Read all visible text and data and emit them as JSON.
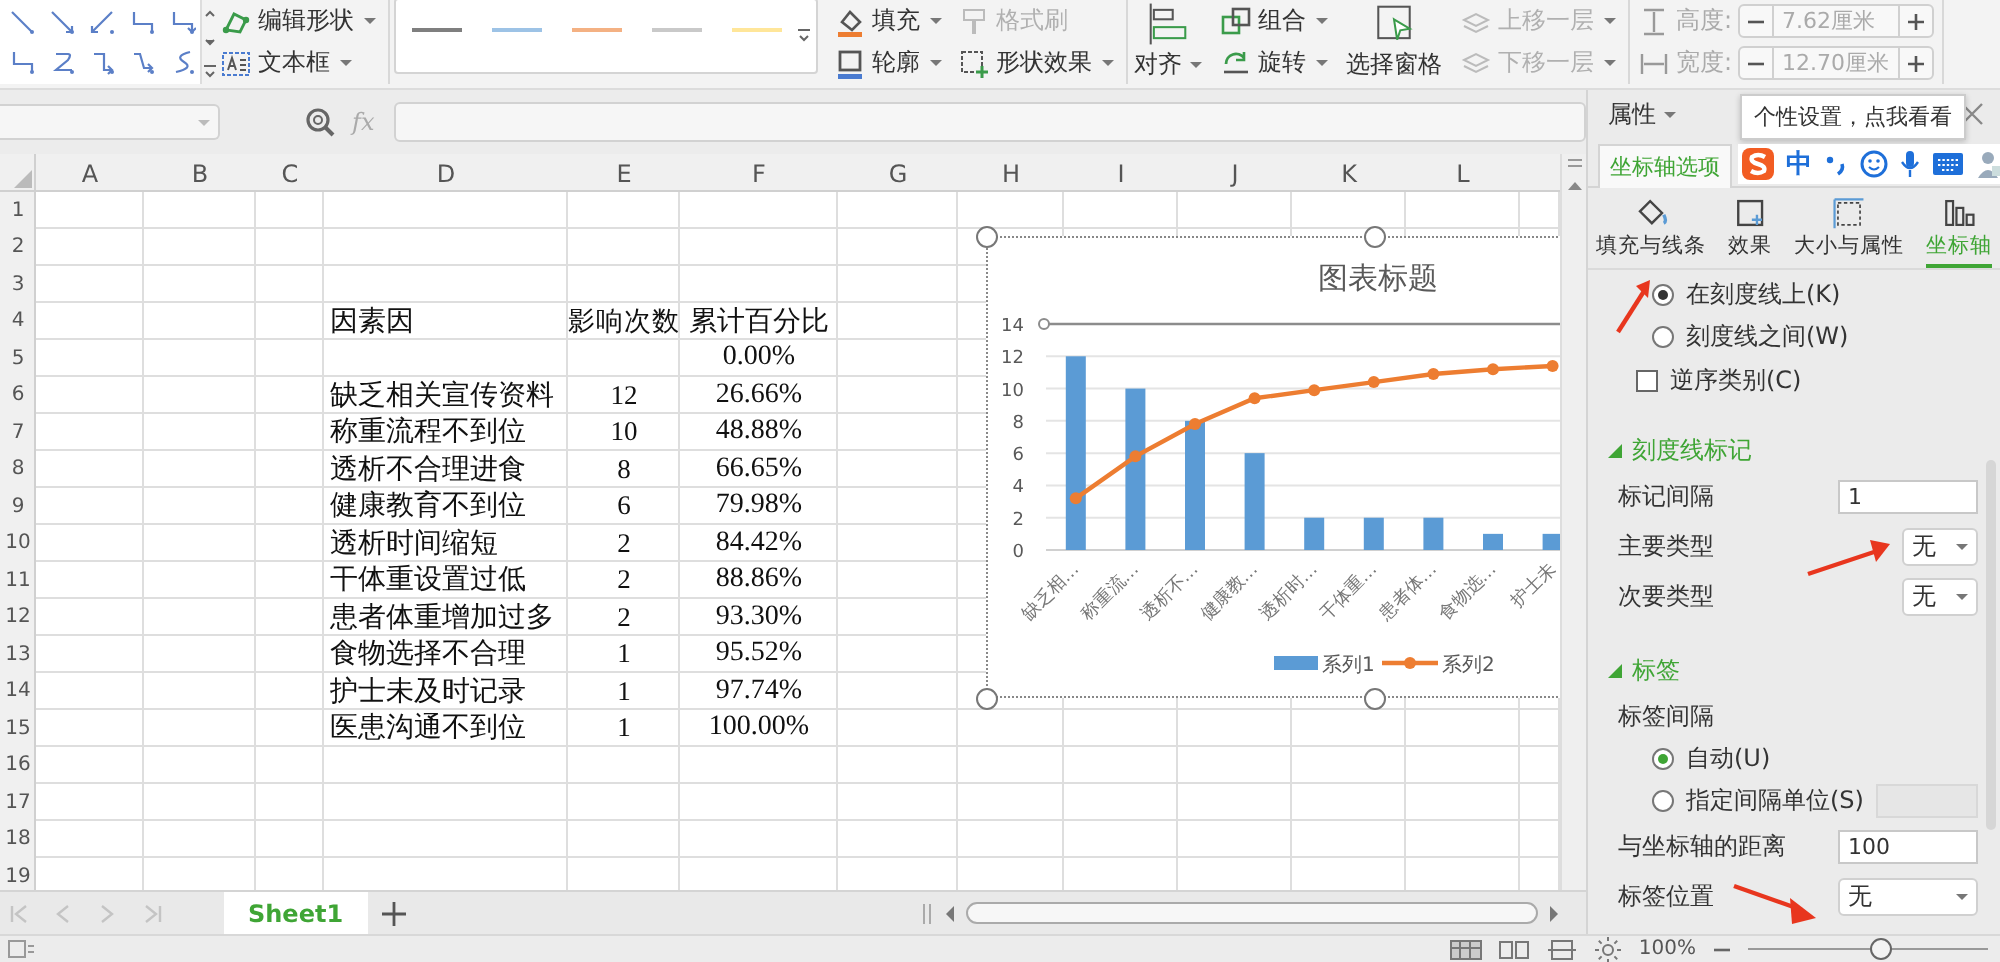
{
  "ribbon": {
    "groups": [
      {
        "columns": [
          {
            "kind": "shape-gallery"
          },
          {
            "kind": "stack",
            "items": [
              {
                "label": "编辑形状",
                "dropdown": true,
                "disabled": false
              },
              {
                "label": "文本框",
                "dropdown": true,
                "disabled": false
              }
            ]
          }
        ]
      },
      {
        "columns": [
          {
            "kind": "style-gallery",
            "swatches": [
              {
                "color": "#7f7f7f"
              },
              {
                "color": "#9dc3e6"
              },
              {
                "color": "#f4b183"
              },
              {
                "color": "#c9c9c9"
              },
              {
                "color": "#ffe699"
              }
            ]
          },
          {
            "kind": "stack",
            "items": [
              {
                "label": "填充",
                "dropdown": true,
                "disabled": false
              },
              {
                "label": "轮廓",
                "dropdown": true,
                "disabled": false
              }
            ]
          },
          {
            "kind": "stack",
            "items": [
              {
                "label": "格式刷",
                "dropdown": false,
                "disabled": true
              },
              {
                "label": "形状效果",
                "dropdown": true,
                "disabled": false
              }
            ]
          }
        ]
      },
      {
        "columns": [
          {
            "kind": "large",
            "item": {
              "label": "对齐",
              "dropdown": true,
              "disabled": false
            }
          },
          {
            "kind": "stack",
            "items": [
              {
                "label": "组合",
                "dropdown": true,
                "disabled": false
              },
              {
                "label": "旋转",
                "dropdown": true,
                "disabled": false
              }
            ]
          },
          {
            "kind": "large",
            "item": {
              "label": "选择窗格",
              "dropdown": false,
              "disabled": false
            }
          },
          {
            "kind": "stack",
            "items": [
              {
                "label": "上移一层",
                "dropdown": true,
                "disabled": true
              },
              {
                "label": "下移一层",
                "dropdown": true,
                "disabled": true
              }
            ]
          }
        ]
      },
      {
        "columns": [
          {
            "kind": "spinners",
            "items": [
              {
                "label": "高度:",
                "value": "7.62厘米",
                "disabled": true
              },
              {
                "label": "宽度:",
                "value": "12.70厘米",
                "disabled": true
              }
            ]
          }
        ]
      }
    ]
  },
  "formula_bar": {
    "fx": "fx"
  },
  "sheet": {
    "columns": [
      "A",
      "B",
      "C",
      "D",
      "E",
      "F",
      "G",
      "H",
      "I",
      "J",
      "K",
      "L"
    ],
    "rows": [
      {
        "number": "1"
      },
      {
        "number": "2"
      },
      {
        "number": "3"
      },
      {
        "number": "4",
        "d": "因素因",
        "e": "影响次数",
        "f": "累计百分比"
      },
      {
        "number": "5",
        "f": "0.00%"
      },
      {
        "number": "6",
        "d": "缺乏相关宣传资料",
        "e": "12",
        "f": "26.66%"
      },
      {
        "number": "7",
        "d": "称重流程不到位",
        "e": "10",
        "f": "48.88%"
      },
      {
        "number": "8",
        "d": "透析不合理进食",
        "e": "8",
        "f": "66.65%"
      },
      {
        "number": "9",
        "d": "健康教育不到位",
        "e": "6",
        "f": "79.98%"
      },
      {
        "number": "10",
        "d": "透析时间缩短",
        "e": "2",
        "f": "84.42%"
      },
      {
        "number": "11",
        "d": "干体重设置过低",
        "e": "2",
        "f": "88.86%"
      },
      {
        "number": "12",
        "d": "患者体重增加过多",
        "e": "2",
        "f": "93.30%"
      },
      {
        "number": "13",
        "d": "食物选择不合理",
        "e": "1",
        "f": "95.52%"
      },
      {
        "number": "14",
        "d": "护士未及时记录",
        "e": "1",
        "f": "97.74%"
      },
      {
        "number": "15",
        "d": "医患沟通不到位",
        "e": "1",
        "f": "100.00%"
      },
      {
        "number": "16"
      },
      {
        "number": "17"
      },
      {
        "number": "18"
      },
      {
        "number": "19"
      }
    ],
    "chart": {
      "chart_data": {
        "type": "bar",
        "title": "图表标题",
        "categories": [
          "缺乏相…",
          "称重流…",
          "透析不…",
          "健康教…",
          "透析时…",
          "干体重…",
          "患者体…",
          "食物选…",
          "护士未"
        ],
        "series": [
          {
            "name": "系列1",
            "color": "#5b9bd5",
            "type": "bar",
            "values": [
              12,
              10,
              8,
              6,
              2,
              2,
              2,
              1,
              1
            ]
          },
          {
            "name": "系列2",
            "color": "#ed7d31",
            "type": "line",
            "marker": "circle",
            "values": [
              3.2,
              5.8,
              7.8,
              9.4,
              9.9,
              10.4,
              10.9,
              11.2,
              11.4
            ]
          }
        ],
        "ylim": [
          0,
          14
        ],
        "yticks": [
          0,
          2,
          4,
          6,
          8,
          10,
          12,
          14
        ],
        "grid": true,
        "legend": "bottom"
      }
    },
    "sheets": [
      {
        "name": "Sheet1",
        "selected": true
      }
    ]
  },
  "panel": {
    "title": "属性",
    "tooltip": "个性设置，点我看看",
    "tab": "坐标轴选项",
    "ime": "中",
    "icon_tabs": [
      {
        "label": "填充与线条",
        "selected": false
      },
      {
        "label": "效果",
        "selected": false
      },
      {
        "label": "大小与属性",
        "selected": false
      },
      {
        "label": "坐标轴",
        "selected": true
      }
    ],
    "options": [
      {
        "kind": "radio",
        "label": "在刻度线上(K)",
        "selected": true
      },
      {
        "kind": "radio",
        "label": "刻度线之间(W)",
        "selected": false
      },
      {
        "kind": "checkbox",
        "label": "逆序类别(C)",
        "checked": false
      },
      {
        "kind": "section",
        "label": "刻度线标记",
        "expanded": true
      },
      {
        "kind": "field",
        "label": "标记间隔",
        "value": "1"
      },
      {
        "kind": "select",
        "label": "主要类型",
        "value": "无"
      },
      {
        "kind": "select",
        "label": "次要类型",
        "value": "无"
      },
      {
        "kind": "section",
        "label": "标签",
        "expanded": true
      },
      {
        "kind": "heading",
        "label": "标签间隔"
      },
      {
        "kind": "radio",
        "label": "自动(U)",
        "selected": true
      },
      {
        "kind": "radio-field",
        "label": "指定间隔单位(S)",
        "selected": false
      },
      {
        "kind": "field",
        "label": "与坐标轴的距离",
        "value": "100"
      },
      {
        "kind": "select",
        "label": "标签位置",
        "value": "无"
      }
    ]
  },
  "status_bar": {
    "zoom": "100%",
    "zoom_slider": {
      "level": 0.55
    }
  }
}
